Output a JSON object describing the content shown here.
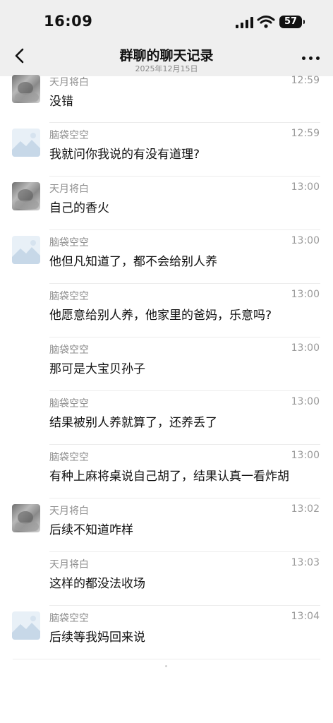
{
  "status_bar": {
    "time": "16:09",
    "battery": "57"
  },
  "header": {
    "title": "群聊的聊天记录",
    "date": "2025年12月15日"
  },
  "messages": [
    {
      "sender": "天月将白",
      "avatar": "cat",
      "time": "12:59",
      "text": "没错"
    },
    {
      "sender": "脑袋空空",
      "avatar": "landscape",
      "time": "12:59",
      "text": "我就问你我说的有没有道理?"
    },
    {
      "sender": "天月将白",
      "avatar": "cat",
      "time": "13:00",
      "text": "自己的香火"
    },
    {
      "sender": "脑袋空空",
      "avatar": "landscape",
      "time": "13:00",
      "text": "他但凡知道了，都不会给别人养"
    },
    {
      "sender": "脑袋空空",
      "avatar": "",
      "time": "13:00",
      "text": "他愿意给别人养，他家里的爸妈，乐意吗?"
    },
    {
      "sender": "脑袋空空",
      "avatar": "",
      "time": "13:00",
      "text": "那可是大宝贝孙子"
    },
    {
      "sender": "脑袋空空",
      "avatar": "",
      "time": "13:00",
      "text": "结果被别人养就算了，还养丢了"
    },
    {
      "sender": "脑袋空空",
      "avatar": "",
      "time": "13:00",
      "text": "有种上麻将桌说自己胡了，结果认真一看炸胡"
    },
    {
      "sender": "天月将白",
      "avatar": "cat",
      "time": "13:02",
      "text": "后续不知道咋样"
    },
    {
      "sender": "天月将白",
      "avatar": "",
      "time": "13:03",
      "text": "这样的都没法收场"
    },
    {
      "sender": "脑袋空空",
      "avatar": "landscape",
      "time": "13:04",
      "text": "后续等我妈回来说"
    }
  ]
}
